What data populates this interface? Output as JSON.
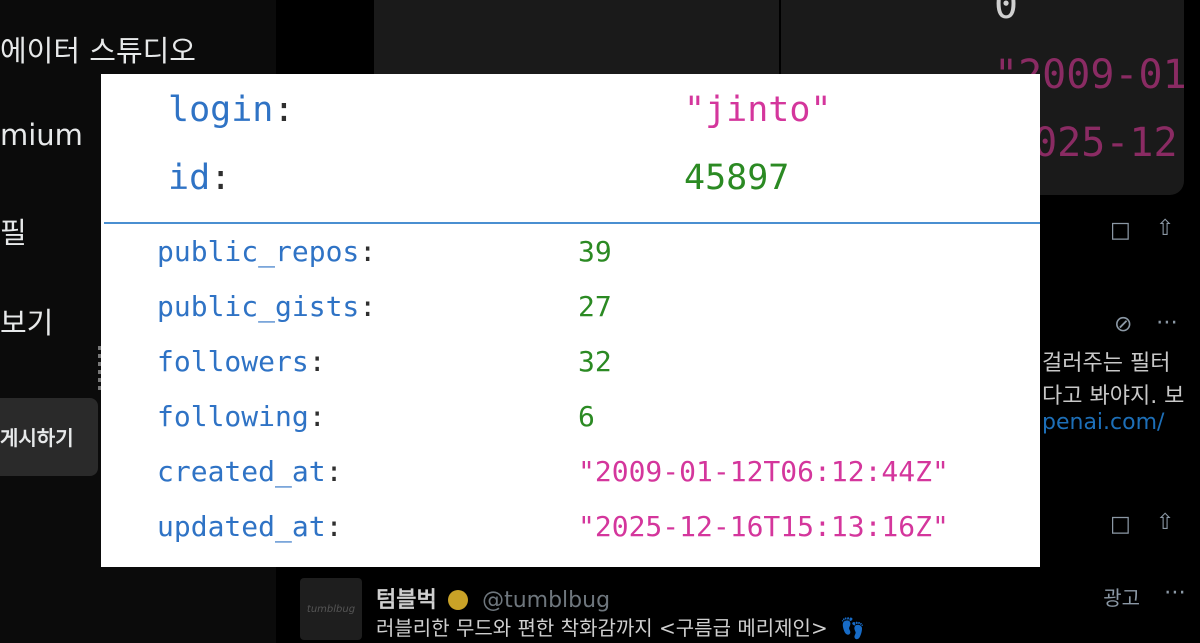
{
  "background": {
    "sidebar": {
      "items": [
        "에이터 스튜디오",
        "mium",
        "필",
        "보기"
      ],
      "post_button": "게시하기"
    },
    "code_card": {
      "lines": [
        "0",
        "\"2009-01",
        "2025-12"
      ]
    },
    "feed": {
      "snippet_lines": [
        "걸러주는 필터",
        "다고 봐야지. 보"
      ],
      "snippet_link": "penai.com/",
      "ad_post": {
        "avatar_text": "tumblbug",
        "name": "텀블벅",
        "handle": "@tumblbug",
        "body": "러블리한 무드와 편한 착화감까지 <구름급 메리제인>",
        "ad_label": "광고"
      }
    }
  },
  "overlay": {
    "header_fields": [
      {
        "key": "login",
        "value": "\"jinto\"",
        "type": "string"
      },
      {
        "key": "id",
        "value": "45897",
        "type": "number"
      }
    ],
    "fields": [
      {
        "key": "public_repos",
        "value": "39",
        "type": "number"
      },
      {
        "key": "public_gists",
        "value": "27",
        "type": "number"
      },
      {
        "key": "followers",
        "value": "32",
        "type": "number"
      },
      {
        "key": "following",
        "value": "6",
        "type": "number"
      },
      {
        "key": "created_at",
        "value": "\"2009-01-12T06:12:44Z\"",
        "type": "string"
      },
      {
        "key": "updated_at",
        "value": "\"2025-12-16T15:13:16Z\"",
        "type": "string"
      }
    ],
    "colon": ":",
    "colors": {
      "key": "#2f73c5",
      "number": "#2b8a23",
      "string": "#d4369c",
      "divider": "#4a8fd1"
    }
  }
}
